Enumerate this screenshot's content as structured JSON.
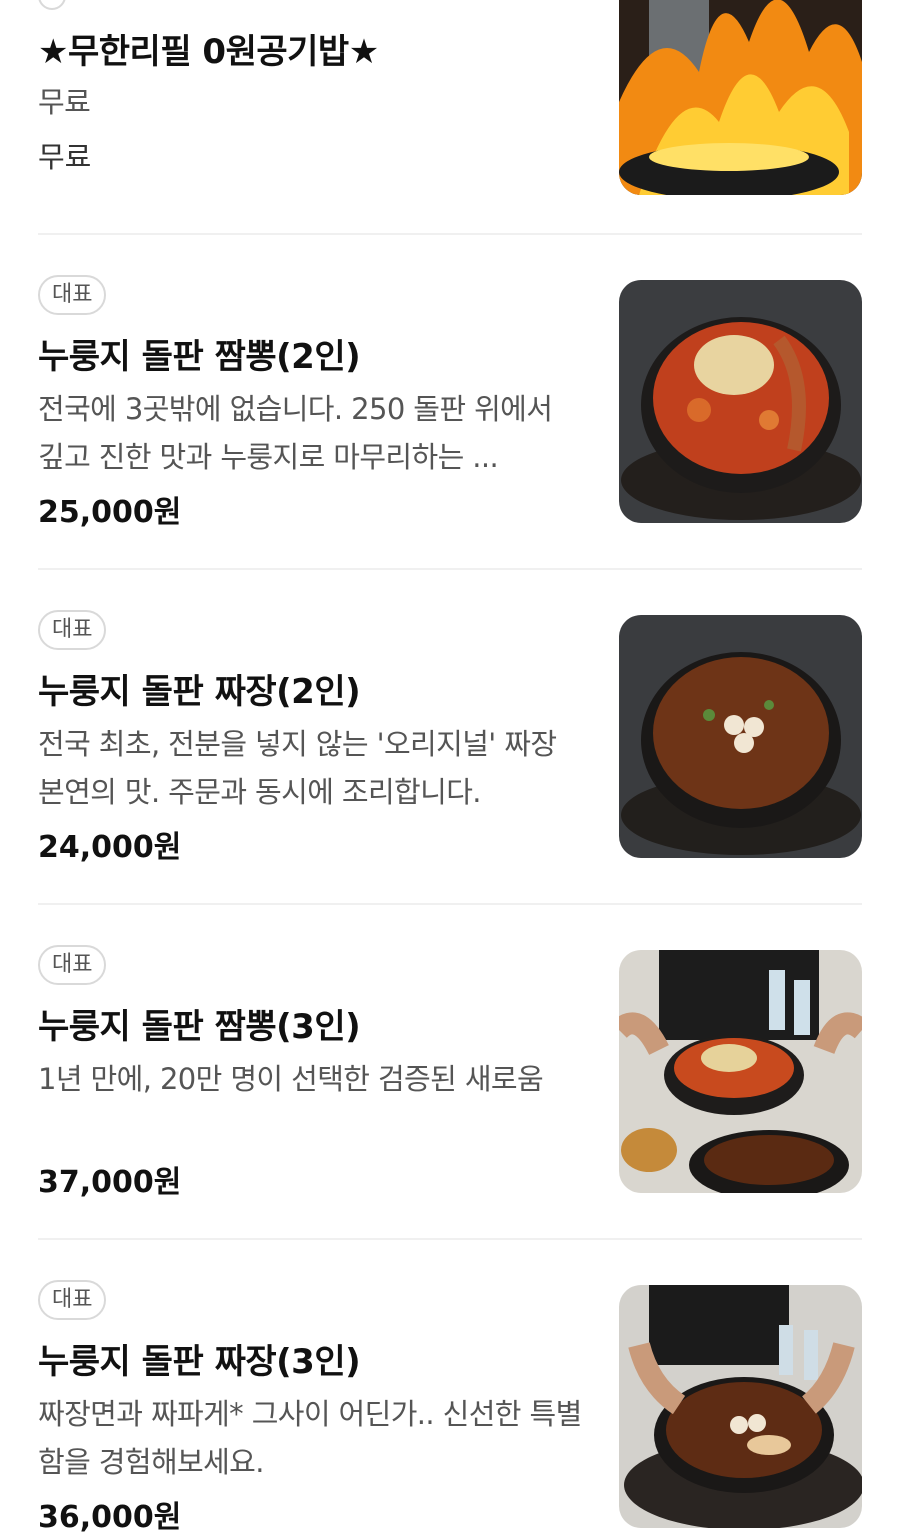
{
  "menu": {
    "items": [
      {
        "badge": "",
        "name": "★무한리필 0원공기밥★",
        "description": "무료",
        "price": "무료",
        "photo_icon": "flaming-wok-photo"
      },
      {
        "badge": "대표",
        "name": "누룽지 돌판 짬뽕(2인)",
        "description": "전국에 3곳밖에 없습니다. 250 돌판 위에서 깊고 진한 맛과 누룽지로 마무리하는 ...",
        "price": "25,000원",
        "photo_icon": "stone-pot-jjamppong-photo"
      },
      {
        "badge": "대표",
        "name": "누룽지 돌판 짜장(2인)",
        "description": "전국 최초, 전분을 넣지 않는 '오리지널' 짜장 본연의 맛. 주문과 동시에 조리합니다.",
        "price": "24,000원",
        "photo_icon": "stone-pot-jjajang-photo"
      },
      {
        "badge": "대표",
        "name": "누룽지 돌판 짬뽕(3인)",
        "description": "1년 만에, 20만 명이 선택한 검증된 새로움",
        "price": "37,000원",
        "photo_icon": "table-spread-photo"
      },
      {
        "badge": "대표",
        "name": "누룽지 돌판 짜장(3인)",
        "description": "짜장면과 짜파게* 그사이 어딘가.. 신선한 특별함을 경험해보세요.",
        "price": "36,000원",
        "photo_icon": "stone-pot-jjajang-serving-photo"
      }
    ]
  }
}
